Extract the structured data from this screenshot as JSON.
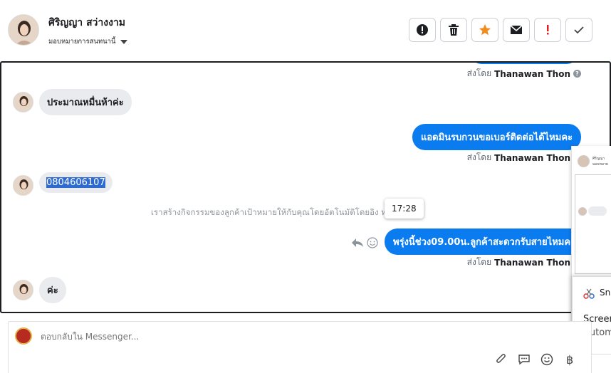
{
  "header": {
    "contact_name": "ศิริญญา สว่างงาม",
    "assign_label": "มอบหมายการสนทนานี้",
    "actions": [
      "alert-icon",
      "trash-icon",
      "star-icon",
      "mail-icon",
      "exclamation-icon",
      "check-icon"
    ],
    "star_color": "#f28b1e",
    "danger_color": "#e02020"
  },
  "messages": {
    "sent_by_prefix": "ส่งโดย",
    "sender_name": "Thanawan Thon",
    "m1": "ประมาณหมื่นห้าค่ะ",
    "m2": "แอดมินรบกวนขอเบอร์ติดต่อได้ไหมคะ",
    "m3": "0804606107",
    "system": "เราสร้างกิจกรรมของลูกค้าเป้าหมายให้กับคุณโดยอัตโนมัติโดยอิง         ทนานี้",
    "tooltip_time": "17:28",
    "m4": "พรุ่งนี้ช่วง09.00น.ลูกค้าสะดวกรับสายไหมคะ",
    "m5": "ค่ะ",
    "outgoing_color": "#0b7cf0"
  },
  "side_panel": {
    "snippet_name": "ศิริญญา",
    "snippet_sub": "มอบหมาย",
    "toast_app": "Sni",
    "toast_line1": "Screen",
    "toast_line2": "Autom"
  },
  "composer": {
    "placeholder": "ตอบกลับใน Messenger...",
    "tools": [
      "attachment-icon",
      "saved-reply-icon",
      "emoji-icon",
      "currency-icon"
    ]
  }
}
